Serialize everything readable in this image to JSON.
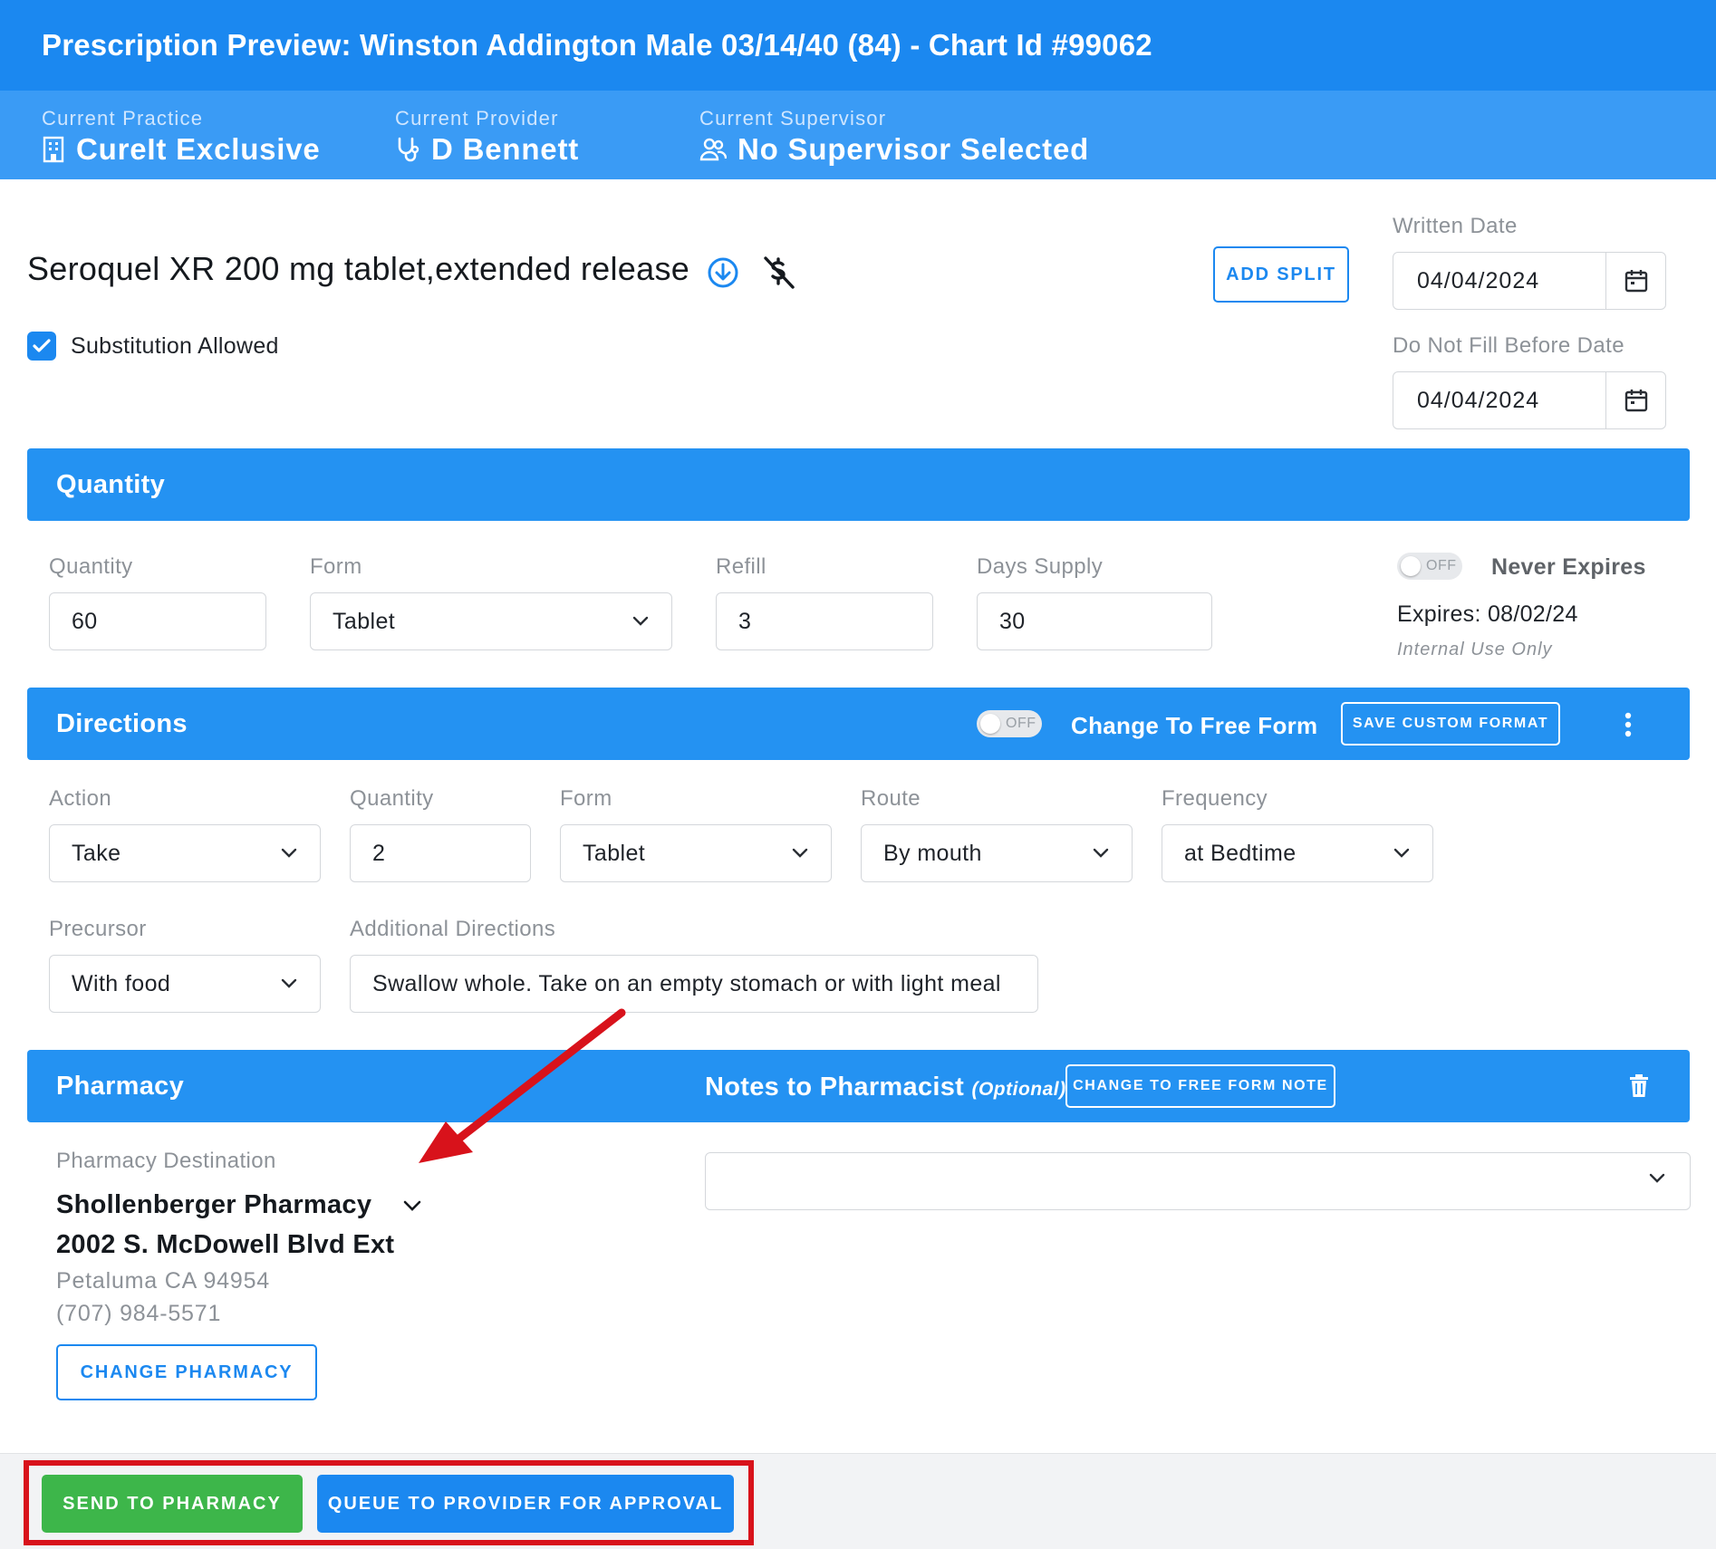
{
  "header": {
    "title": "Prescription Preview: Winston Addington Male 03/14/40 (84) - Chart Id #99062",
    "practice_label": "Current Practice",
    "practice_value": "CureIt Exclusive",
    "provider_label": "Current Provider",
    "provider_value": "D Bennett",
    "supervisor_label": "Current Supervisor",
    "supervisor_value": "No Supervisor Selected"
  },
  "drug": {
    "name": "Seroquel XR 200 mg tablet,extended release",
    "substitution_label": "Substitution Allowed",
    "substitution_checked": true,
    "add_split_label": "ADD SPLIT"
  },
  "dates": {
    "written_label": "Written Date",
    "written_value": "04/04/2024",
    "dnf_label": "Do Not Fill Before Date",
    "dnf_value": "04/04/2024"
  },
  "quantity_section": {
    "title": "Quantity",
    "quantity_label": "Quantity",
    "quantity_value": "60",
    "form_label": "Form",
    "form_value": "Tablet",
    "refill_label": "Refill",
    "refill_value": "3",
    "days_label": "Days Supply",
    "days_value": "30",
    "toggle_text": "OFF",
    "never_expires_label": "Never Expires",
    "expires_text": "Expires: 08/02/24",
    "internal_text": "Internal Use Only"
  },
  "directions_section": {
    "title": "Directions",
    "toggle_text": "OFF",
    "free_form_label": "Change To Free Form",
    "save_format_label": "SAVE CUSTOM FORMAT",
    "action_label": "Action",
    "action_value": "Take",
    "quantity_label": "Quantity",
    "quantity_value": "2",
    "form_label": "Form",
    "form_value": "Tablet",
    "route_label": "Route",
    "route_value": "By mouth",
    "frequency_label": "Frequency",
    "frequency_value": "at Bedtime",
    "precursor_label": "Precursor",
    "precursor_value": "With food",
    "additional_label": "Additional Directions",
    "additional_value": "Swallow whole. Take on an empty stomach or with light meal"
  },
  "pharmacy_section": {
    "title": "Pharmacy",
    "notes_title": "Notes to Pharmacist",
    "notes_optional": "(Optional)",
    "free_form_note_label": "CHANGE TO FREE FORM NOTE",
    "destination_label": "Pharmacy Destination",
    "pharmacy_name": "Shollenberger Pharmacy",
    "pharmacy_address": "2002 S. McDowell Blvd Ext",
    "pharmacy_city": "Petaluma CA 94954",
    "pharmacy_phone": "(707) 984-5571",
    "change_pharmacy_label": "CHANGE PHARMACY",
    "notes_value": ""
  },
  "footer": {
    "send_label": "SEND TO PHARMACY",
    "queue_label": "QUEUE TO PROVIDER FOR APPROVAL"
  },
  "colors": {
    "primary": "#1b88f0",
    "section": "#2492f2",
    "send_green": "#3db64a",
    "annotation_red": "#d8121b"
  },
  "icons": [
    "building-icon",
    "stethoscope-icon",
    "users-icon",
    "download-circle-icon",
    "no-dollar-icon",
    "calendar-icon",
    "chevron-down-icon",
    "more-vertical-icon",
    "trash-icon",
    "check-icon"
  ]
}
